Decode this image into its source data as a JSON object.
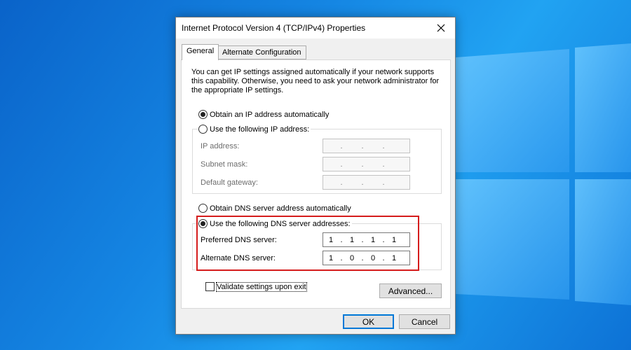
{
  "dialog": {
    "title": "Internet Protocol Version 4 (TCP/IPv4) Properties",
    "close_icon": "close-icon"
  },
  "tabs": [
    {
      "label": "General",
      "selected": true
    },
    {
      "label": "Alternate Configuration",
      "selected": false
    }
  ],
  "intro_text": "You can get IP settings assigned automatically if your network supports this capability. Otherwise, you need to ask your network administrator for the appropriate IP settings.",
  "ip_section": {
    "auto_label": "Obtain an IP address automatically",
    "auto_selected": true,
    "manual_label": "Use the following IP address:",
    "manual_selected": false,
    "ip_label": "IP address:",
    "subnet_label": "Subnet mask:",
    "gateway_label": "Default gateway:"
  },
  "dns_section": {
    "auto_label": "Obtain DNS server address automatically",
    "auto_selected": false,
    "manual_label": "Use the following DNS server addresses:",
    "manual_selected": true,
    "preferred_label": "Preferred DNS server:",
    "preferred_octets": [
      "1",
      "1",
      "1",
      "1"
    ],
    "alternate_label": "Alternate DNS server:",
    "alternate_octets": [
      "1",
      "0",
      "0",
      "1"
    ]
  },
  "validate_label": "Validate settings upon exit",
  "validate_checked": false,
  "buttons": {
    "advanced": "Advanced...",
    "ok": "OK",
    "cancel": "Cancel"
  },
  "colors": {
    "highlight": "#d51c1c",
    "ok_border": "#0078d7"
  }
}
